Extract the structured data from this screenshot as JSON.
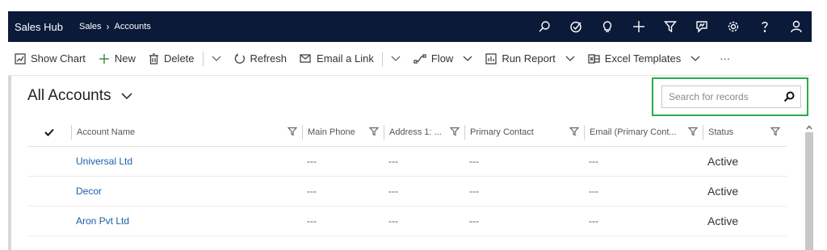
{
  "topbar": {
    "app_name": "Sales Hub",
    "breadcrumb": [
      "Sales",
      "Accounts"
    ],
    "icons": [
      "search-icon",
      "task-icon",
      "lightbulb-icon",
      "plus-icon",
      "filter-icon",
      "assistant-icon",
      "gear-icon",
      "help-icon",
      "user-icon"
    ]
  },
  "commands": {
    "show_chart": "Show Chart",
    "new": "New",
    "delete": "Delete",
    "refresh": "Refresh",
    "email_link": "Email a Link",
    "flow": "Flow",
    "run_report": "Run Report",
    "excel_templates": "Excel Templates",
    "more": "···"
  },
  "view": {
    "title": "All Accounts"
  },
  "search": {
    "placeholder": "Search for records",
    "highlight_color": "#2fa84f"
  },
  "grid": {
    "columns": [
      "Account Name",
      "Main Phone",
      "Address 1: ...",
      "Primary Contact",
      "Email (Primary Cont...",
      "Status"
    ],
    "rows": [
      {
        "name": "Universal Ltd",
        "phone": "---",
        "address": "---",
        "contact": "---",
        "email": "---",
        "status": "Active"
      },
      {
        "name": "Decor",
        "phone": "---",
        "address": "---",
        "contact": "---",
        "email": "---",
        "status": "Active"
      },
      {
        "name": "Aron Pvt Ltd",
        "phone": "---",
        "address": "---",
        "contact": "---",
        "email": "---",
        "status": "Active"
      }
    ]
  },
  "colors": {
    "nav_bg": "#0b1a39",
    "link": "#1a5fa8"
  }
}
